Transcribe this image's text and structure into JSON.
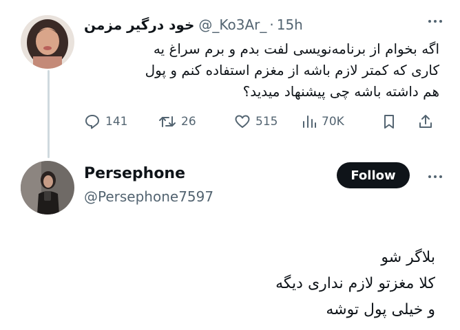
{
  "tweet": {
    "display_name": "خود درگیر مزمن",
    "handle": "@_Ko3Ar_",
    "separator": "·",
    "time": "15h",
    "text_lines": [
      "اگه بخوام از برنامه‌نویسی لفت بدم و برم سراغ یه",
      "کاری که کمتر لازم باشه از مغزم استفاده کنم و پول",
      "هم داشته باشه چی پیشنهاد میدید؟"
    ],
    "stats": {
      "replies": "141",
      "retweets": "26",
      "likes": "515",
      "views": "70K"
    }
  },
  "reply": {
    "display_name": "Persephone",
    "handle": "@Persephone7597",
    "follow_label": "Follow",
    "text_lines": [
      "بلاگر شو",
      "کلا مغزتو لازم نداری دیگه",
      "و خیلی پول توشه"
    ]
  },
  "colors": {
    "text": "#0f1419",
    "secondary": "#536471",
    "thread_line": "#cfd9de",
    "follow_bg": "#0f1419"
  },
  "icons": [
    "more-icon",
    "reply-icon",
    "retweet-icon",
    "like-icon",
    "views-icon",
    "bookmark-icon",
    "share-icon"
  ]
}
